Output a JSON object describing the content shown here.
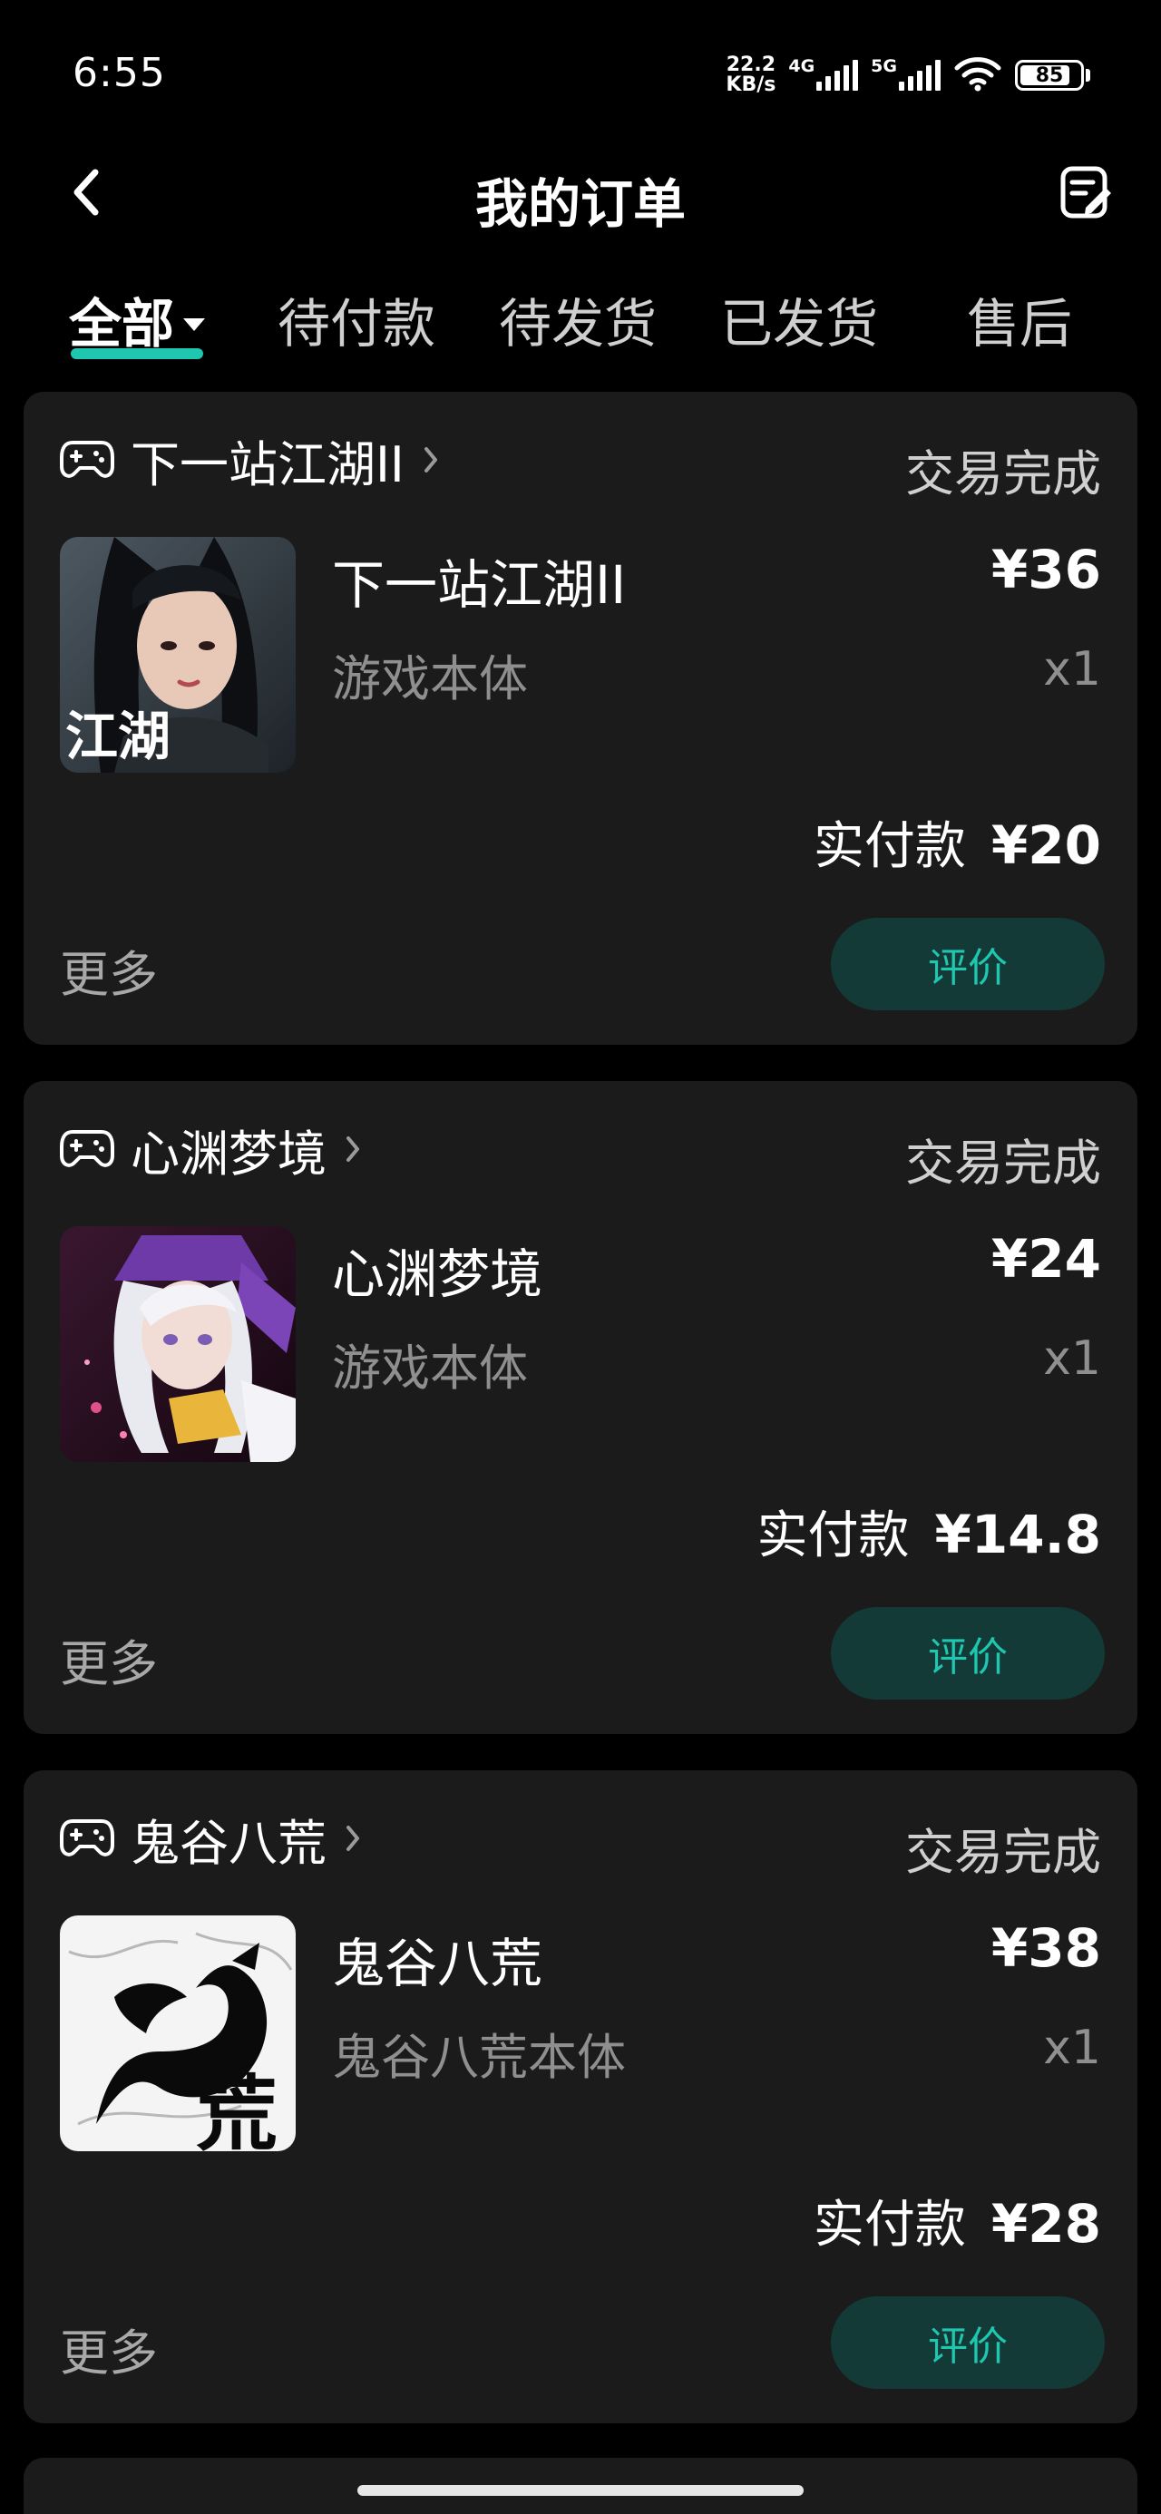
{
  "status_bar": {
    "time": "6:55",
    "net_speed_value": "22.2",
    "net_speed_unit": "KB/s",
    "sim1_label": "4G",
    "sim2_label": "5G",
    "battery": "85",
    "battery_level": 0.85
  },
  "header": {
    "title": "我的订单",
    "back_icon": "chevron-left-icon",
    "edit_icon": "edit-note-icon"
  },
  "tabs": [
    {
      "label": "全部",
      "active": true
    },
    {
      "label": "待付款",
      "active": false
    },
    {
      "label": "待发货",
      "active": false
    },
    {
      "label": "已发货",
      "active": false
    },
    {
      "label": "售后",
      "active": false
    }
  ],
  "orders": [
    {
      "shop": "下一站江湖II",
      "status": "交易完成",
      "item_title": "下一站江湖II",
      "item_sub": "游戏本体",
      "price": "¥36",
      "qty": "x1",
      "paid_label": "实付款",
      "paid_value": "¥20",
      "more": "更多",
      "action": "评价",
      "cover_text": "江湖"
    },
    {
      "shop": "心渊梦境",
      "status": "交易完成",
      "item_title": "心渊梦境",
      "item_sub": "游戏本体",
      "price": "¥24",
      "qty": "x1",
      "paid_label": "实付款",
      "paid_value": "¥14.8",
      "more": "更多",
      "action": "评价"
    },
    {
      "shop": "鬼谷八荒",
      "status": "交易完成",
      "item_title": "鬼谷八荒",
      "item_sub": "鬼谷八荒本体",
      "price": "¥38",
      "qty": "x1",
      "paid_label": "实付款",
      "paid_value": "¥28",
      "more": "更多",
      "action": "评价",
      "cover_text": "荒"
    }
  ],
  "colors": {
    "background": "#000000",
    "card": "#1b1b1b",
    "accent": "#1fc6b0",
    "button_bg": "#143a37",
    "muted_text": "#8f8f8f"
  }
}
